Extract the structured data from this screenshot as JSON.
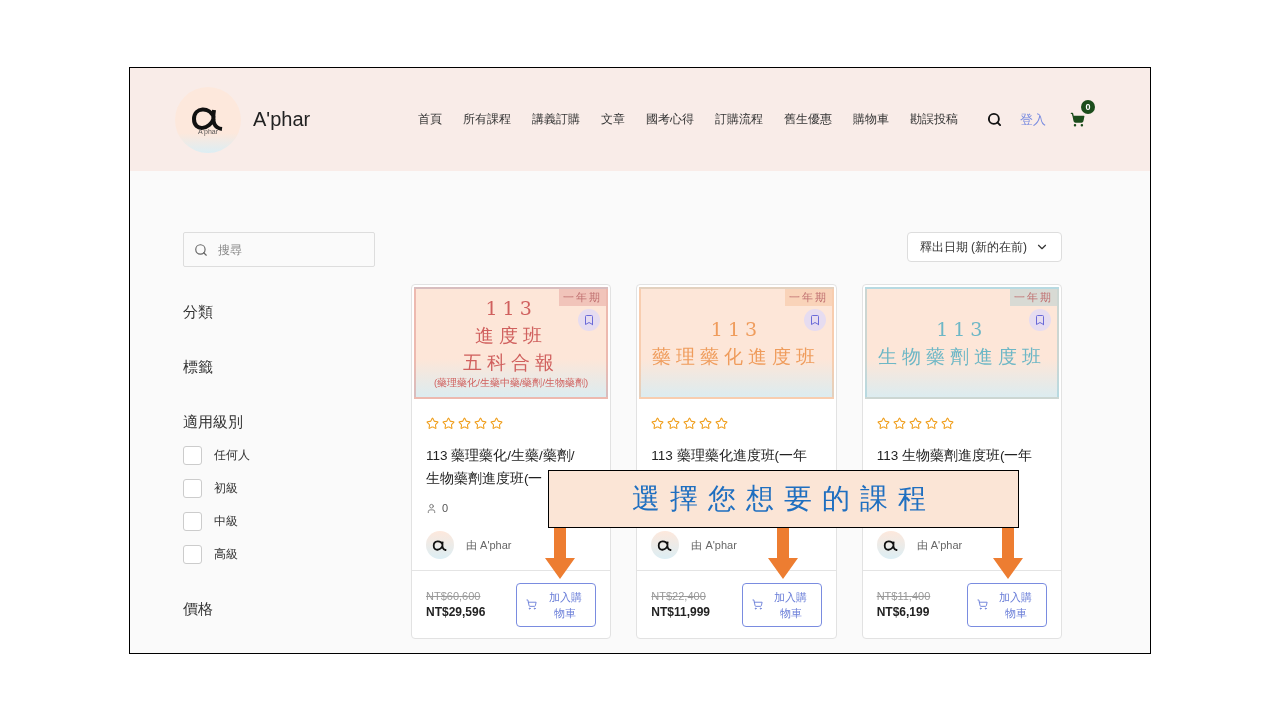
{
  "header": {
    "logo_caption": "A'phar",
    "site_name": "A'phar",
    "nav": [
      "首頁",
      "所有課程",
      "講義訂購",
      "文章",
      "國考心得",
      "訂購流程",
      "舊生優惠",
      "購物車",
      "勘誤投稿"
    ],
    "login": "登入",
    "cart_count": "0"
  },
  "sidebar": {
    "search_placeholder": "搜尋",
    "sections": [
      {
        "title": "分類"
      },
      {
        "title": "標籤"
      },
      {
        "title": "適用級別",
        "options": [
          {
            "label": "任何人",
            "checked": false
          },
          {
            "label": "初級",
            "checked": false
          },
          {
            "label": "中級",
            "checked": false
          },
          {
            "label": "高級",
            "checked": false
          }
        ]
      },
      {
        "title": "價格"
      }
    ]
  },
  "sort": {
    "label": "釋出日期 (新的在前)"
  },
  "courses": [
    {
      "badge": "一年期",
      "color": "#d0605e",
      "banner_lines": [
        "113",
        "進度班",
        "五科合報"
      ],
      "banner_note": "(藥理藥化/生藥中藥/藥劑/生物藥劑)",
      "stars": 0,
      "title_lines": [
        "113 藥理藥化/生藥/藥劑/",
        "生物藥劑進度班(一"
      ],
      "students": "0",
      "author": "由 A'phar",
      "old_price": "NT$60,600",
      "price": "NT$29,596",
      "button": "加入購物車"
    },
    {
      "badge": "一年期",
      "color": "#ef9c5c",
      "banner_lines": [
        "113",
        "藥理藥化進度班"
      ],
      "stars": 0,
      "title_lines": [
        "113 藥理藥化進度班(一年"
      ],
      "author": "由 A'phar",
      "old_price": "NT$22,400",
      "price": "NT$11,999",
      "button": "加入購物車"
    },
    {
      "badge": "一年期",
      "color": "#6db7c6",
      "banner_lines": [
        "113",
        "生物藥劑進度班"
      ],
      "stars": 0,
      "title_lines": [
        "113 生物藥劑進度班(一年"
      ],
      "author": "由 A'phar",
      "old_price": "NT$11,400",
      "price": "NT$6,199",
      "button": "加入購物車"
    }
  ],
  "callout": {
    "text": "選擇您想要的課程"
  }
}
